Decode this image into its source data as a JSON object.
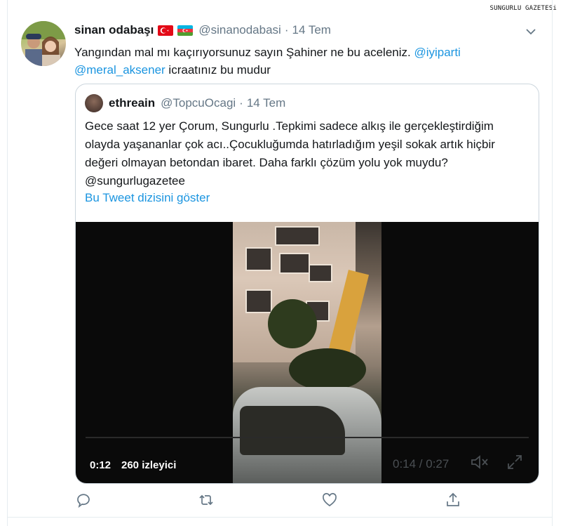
{
  "watermark": "SUNGURLU GAZETESi",
  "tweet": {
    "author_name": "sinan odabaşı",
    "handle": "@sinanodabasi",
    "separator": "·",
    "time": "14 Tem",
    "text_part1": "Yangından mal mı kaçırıyorsunuz sayın Şahiner ne bu aceleniz. ",
    "mention1": "@iyiparti",
    "mention2": "@meral_aksener",
    "text_part2": " icraatınız bu mudur"
  },
  "quote": {
    "author_name": "ethreain",
    "handle": "@TopcuOcagi",
    "separator": "·",
    "time": "14 Tem",
    "text": "Gece saat 12 yer Çorum, Sungurlu .Tepkimi sadece alkış ile gerçekleştirdiğim olayda yaşananlar çok acı..Çocukluğumda hatırladığım yeşil sokak artık hiçbir değeri olmayan betondan ibaret. Daha farklı çözüm yolu yok muydu? @sungurlugazetee",
    "thread_link": "Bu Tweet dizisini göster"
  },
  "video": {
    "elapsed": "0:12",
    "views": "260 izleyici",
    "duration": "0:14 / 0:27"
  },
  "icons": {
    "caret": "chevron-down-icon",
    "reply": "reply-icon",
    "retweet": "retweet-icon",
    "like": "heart-icon",
    "share": "share-icon",
    "mute": "speaker-muted-icon",
    "fullscreen": "fullscreen-icon"
  },
  "colors": {
    "link": "#1b95e0",
    "secondary_text": "#657786",
    "border": "#ccd6dd"
  }
}
